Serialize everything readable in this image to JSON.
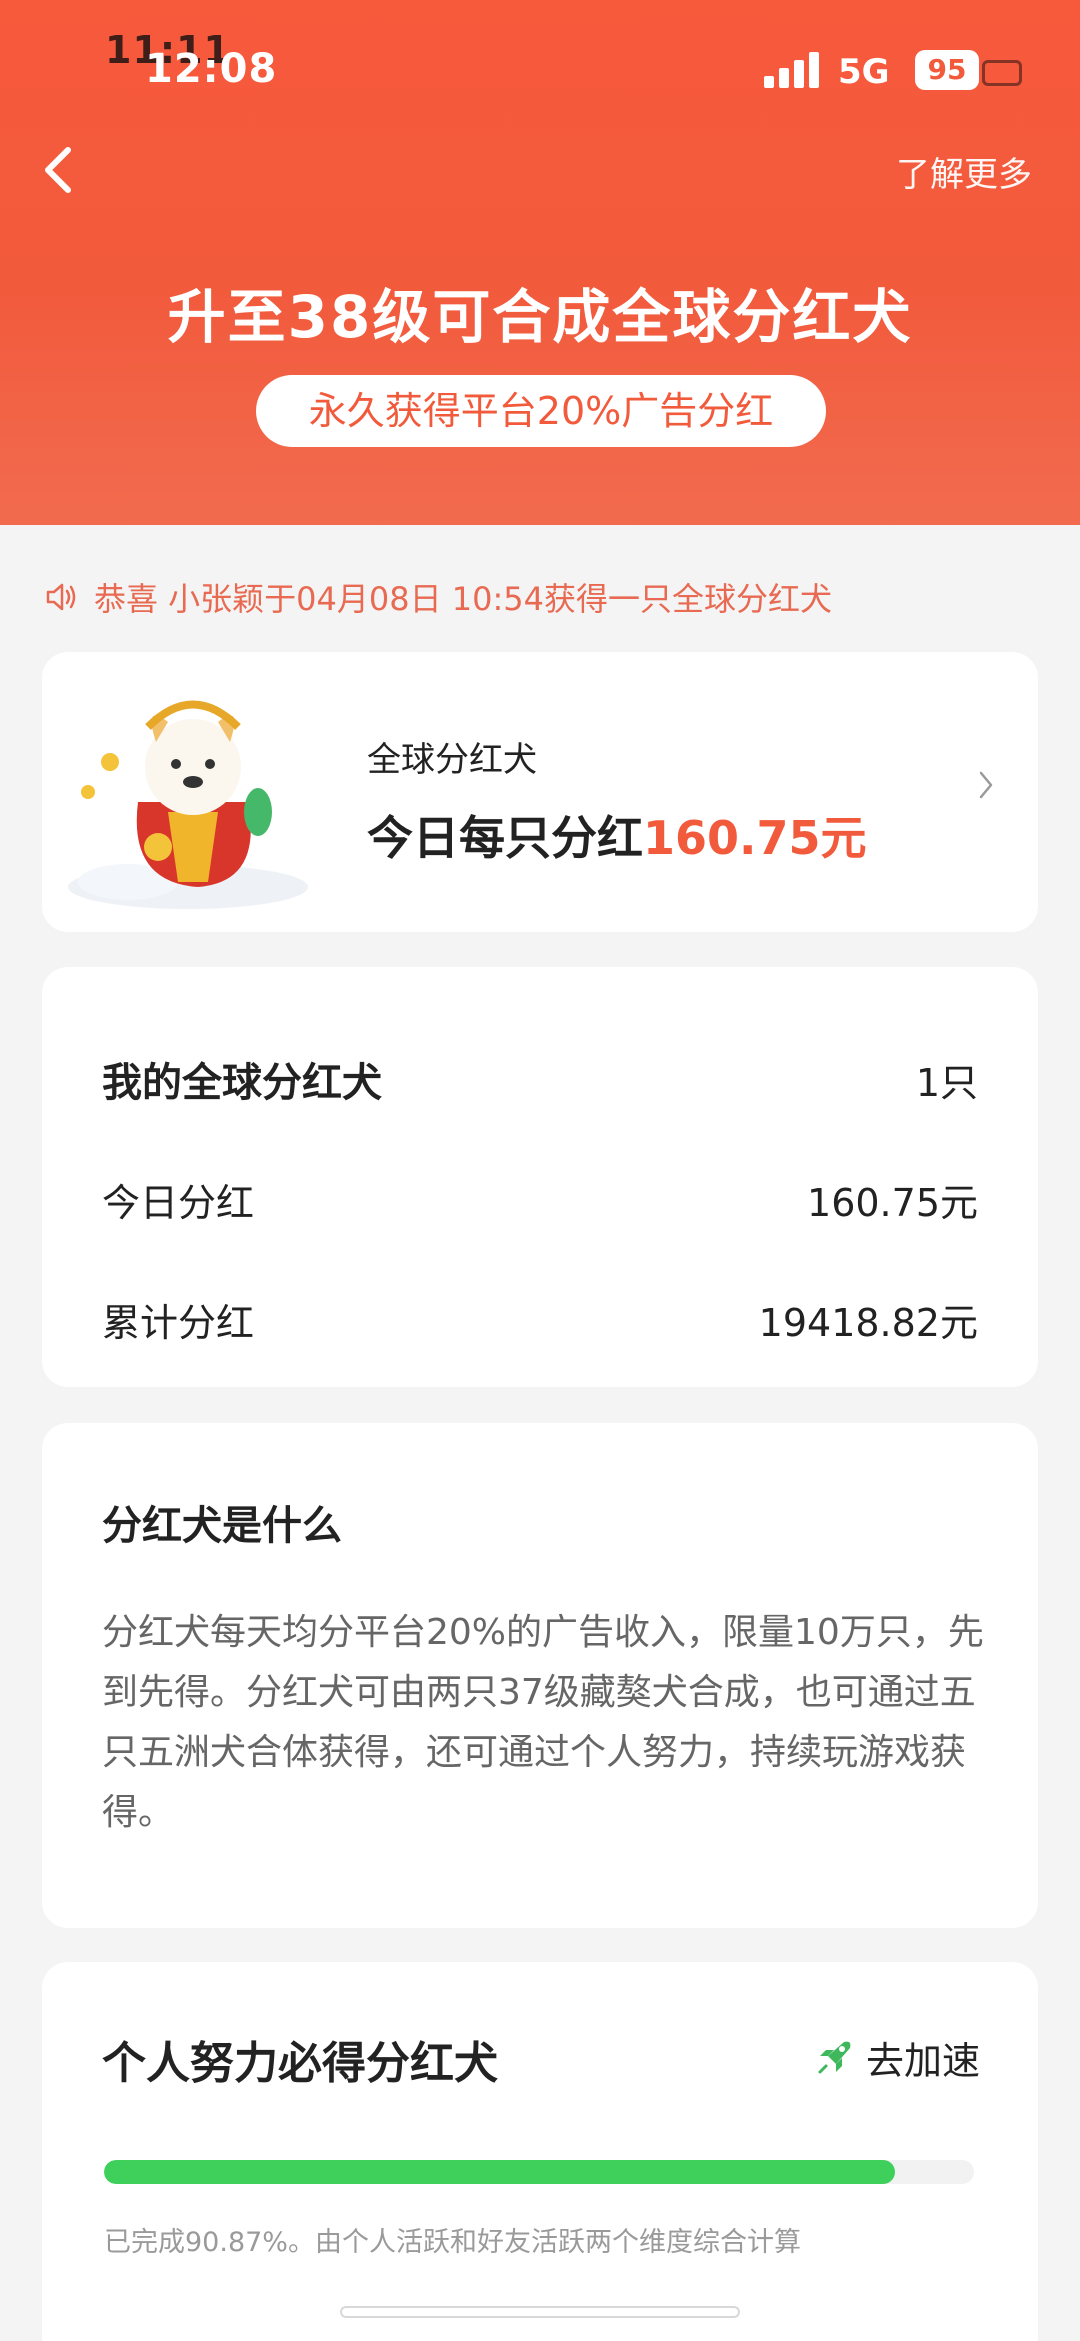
{
  "status_bar": {
    "time_ghost": "11:11",
    "time": "12:08",
    "network": "5G",
    "battery": "95"
  },
  "header": {
    "learn_more": "了解更多",
    "title": "升至38级可合成全球分红犬",
    "subtitle": "永久获得平台20%广告分红"
  },
  "notice": {
    "text": "恭喜 小张颖于04月08日 10:54获得一只全球分红犬"
  },
  "dog_card": {
    "name": "全球分红犬",
    "dividend_label": "今日每只分红",
    "dividend_amount": "160.75元"
  },
  "my_dogs": {
    "title": "我的全球分红犬",
    "count": "1只",
    "rows": [
      {
        "label": "今日分红",
        "value": "160.75元"
      },
      {
        "label": "累计分红",
        "value": "19418.82元"
      }
    ]
  },
  "about": {
    "title": "分红犬是什么",
    "body": "分红犬每天均分平台20%的广告收入，限量10万只，先到先得。分红犬可由两只37级藏獒犬合成，也可通过五只五洲犬合体获得，还可通过个人努力，持续玩游戏获得。"
  },
  "effort": {
    "title": "个人努力必得分红犬",
    "speedup_label": "去加速",
    "progress_fraction": 0.9087,
    "progress_note": "已完成90.87%。由个人活跃和好友活跃两个维度综合计算"
  },
  "colors": {
    "brand": "#f25a3c",
    "progress": "#3fcf5b"
  },
  "icons": {
    "back": "chevron-left-icon",
    "speaker": "speaker-icon",
    "more": "chevron-right-icon",
    "speedup": "rocket-icon"
  }
}
